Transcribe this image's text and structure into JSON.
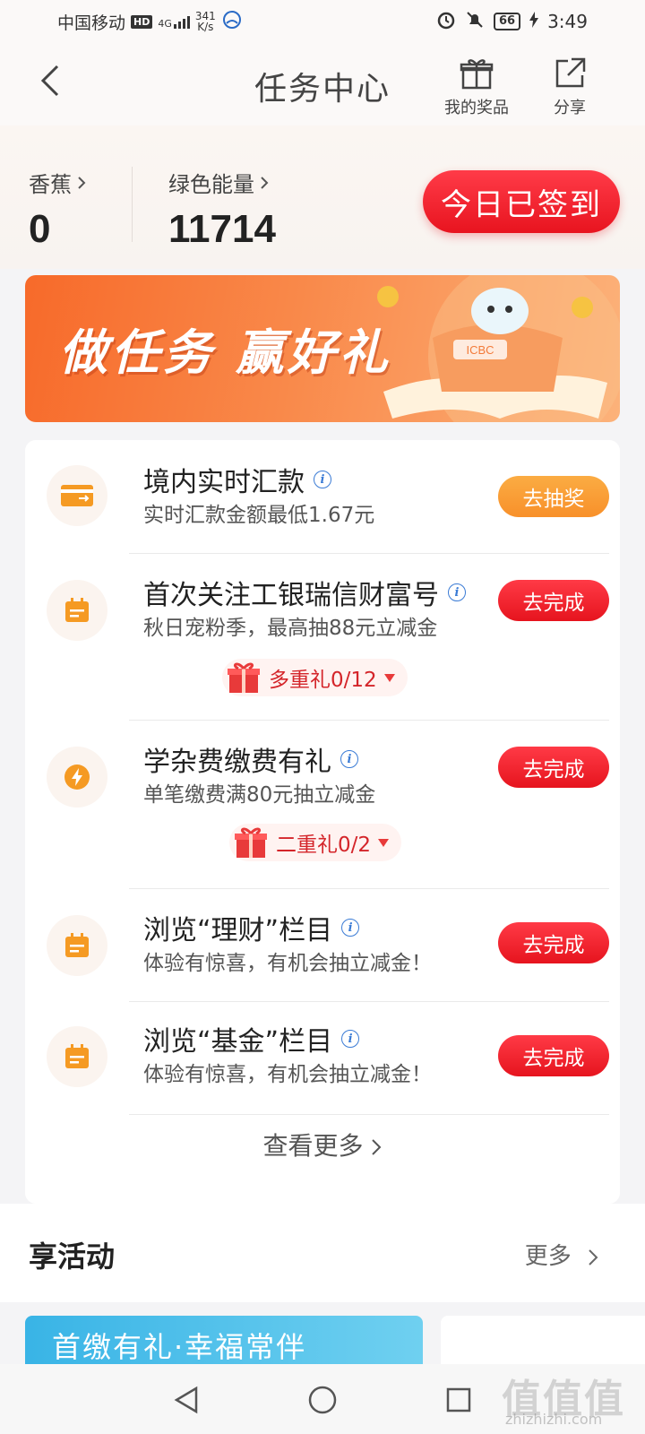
{
  "status_bar": {
    "carrier": "中国移动",
    "hd": "HD",
    "network": "4G",
    "speed_value": "341",
    "speed_unit": "K/s",
    "battery": "66",
    "time": "3:49"
  },
  "header": {
    "title": "任务中心",
    "prize_label": "我的奖品",
    "share_label": "分享"
  },
  "stats": {
    "banana_label": "香蕉",
    "banana_value": "0",
    "energy_label": "绿色能量",
    "energy_value": "11714",
    "signin_label": "今日已签到"
  },
  "banner": {
    "slogan": "做任务 赢好礼",
    "badge_text": "ICBC"
  },
  "tasks": [
    {
      "title": "境内实时汇款",
      "desc": "实时汇款金额最低1.67元",
      "button": "去抽奖",
      "icon": "card-transfer-icon"
    },
    {
      "title": "首次关注工银瑞信财富号",
      "desc": "秋日宠粉季，最高抽88元立减金",
      "button": "去完成",
      "icon": "calendar-icon",
      "gift": "多重礼0/12"
    },
    {
      "title": "学杂费缴费有礼",
      "desc": "单笔缴费满80元抽立减金",
      "button": "去完成",
      "icon": "lightning-icon",
      "gift": "二重礼0/2"
    },
    {
      "title": "浏览“理财”栏目",
      "desc": "体验有惊喜，有机会抽立减金！",
      "button": "去完成",
      "icon": "calendar-icon"
    },
    {
      "title": "浏览“基金”栏目",
      "desc": "体验有惊喜，有机会抽立减金！",
      "button": "去完成",
      "icon": "calendar-icon"
    }
  ],
  "see_more": "查看更多",
  "activities": {
    "title": "享活动",
    "more": "更多",
    "banner_text": "首缴有礼·幸福常伴"
  },
  "watermark": {
    "main": "值值值",
    "sub": "zhizhizhi.com"
  },
  "colors": {
    "accent_red": "#e6141e",
    "accent_orange": "#f8902a",
    "icon_orange": "#f59a23"
  }
}
